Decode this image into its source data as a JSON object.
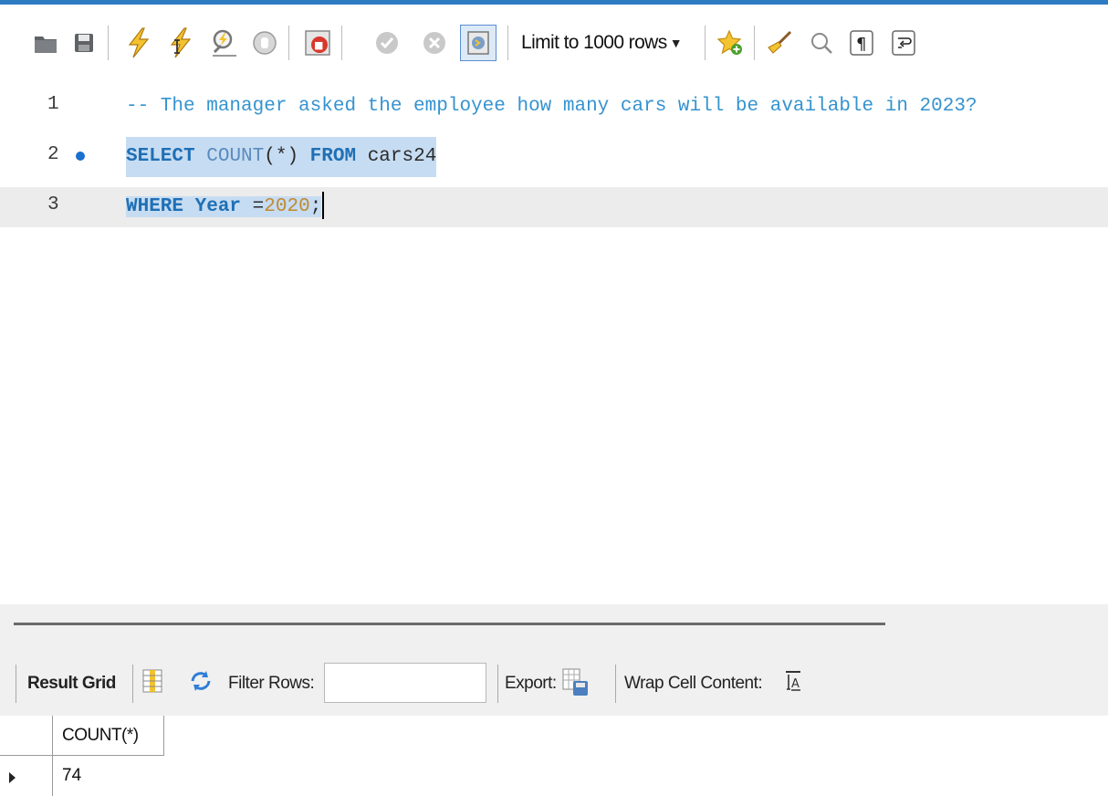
{
  "toolbar": {
    "buttons": [
      {
        "name": "open-sql-file",
        "icon": "folder-icon"
      },
      {
        "name": "save-script",
        "icon": "save-icon"
      },
      {
        "name": "execute-all",
        "icon": "lightning-icon"
      },
      {
        "name": "execute-current",
        "icon": "lightning-cursor-icon"
      },
      {
        "name": "explain-query",
        "icon": "magnifier-lightning-icon"
      },
      {
        "name": "stop-query",
        "icon": "stop-hand-icon"
      },
      {
        "name": "toggle-stop-on-error",
        "icon": "stop-on-error-icon"
      },
      {
        "name": "commit",
        "icon": "check-circle-icon"
      },
      {
        "name": "rollback",
        "icon": "x-circle-icon"
      },
      {
        "name": "toggle-autocommit",
        "icon": "autocommit-icon"
      },
      {
        "name": "add-snippet",
        "icon": "star-add-icon"
      },
      {
        "name": "beautify",
        "icon": "broom-icon"
      },
      {
        "name": "find-replace",
        "icon": "search-icon"
      },
      {
        "name": "toggle-invisibles",
        "icon": "pilcrow-icon"
      },
      {
        "name": "toggle-wrap",
        "icon": "wrap-icon"
      }
    ],
    "limit_label": "Limit to 1000 rows"
  },
  "editor": {
    "lines": [
      {
        "number": "1",
        "comment": "-- The manager asked the employee how many cars will be available in 2023?"
      },
      {
        "number": "2",
        "kw1": "SELECT",
        "fn": "COUNT",
        "args": "(*)",
        "kw2": "FROM",
        "table": "cars24"
      },
      {
        "number": "3",
        "kw1": "WHERE",
        "col": "Year",
        "op": "=",
        "num": "2020",
        "end": ";"
      }
    ]
  },
  "result": {
    "tab_label": "Result Grid",
    "filter_label": "Filter Rows:",
    "filter_value": "",
    "export_label": "Export:",
    "wrap_label": "Wrap Cell Content:",
    "columns": [
      "COUNT(*)"
    ],
    "rows": [
      [
        "74"
      ]
    ]
  },
  "colors": {
    "accent": "#2e7bc4",
    "selection": "#c6dcf2",
    "comment": "#3593cf",
    "keyword": "#1f6fb5",
    "number": "#c28a2e",
    "breakpoint": "#1a6fd0"
  }
}
